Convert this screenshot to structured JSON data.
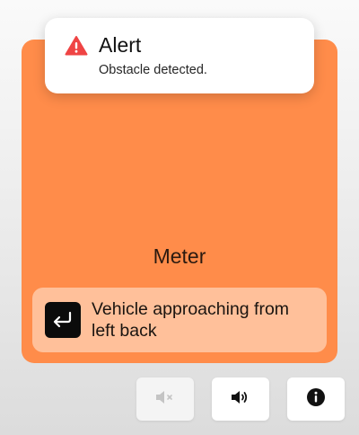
{
  "alert": {
    "title": "Alert",
    "message": "Obstacle detected.",
    "icon": "warning-icon",
    "icon_color": "#ef4444"
  },
  "panel": {
    "background": "#ff8c4a",
    "label": "Meter",
    "notice": {
      "icon": "return-arrow-icon",
      "text": "Vehicle approaching from left back"
    }
  },
  "controls": [
    {
      "name": "mute",
      "icon": "speaker-muted-icon",
      "enabled": false
    },
    {
      "name": "volume",
      "icon": "speaker-volume-icon",
      "enabled": true
    },
    {
      "name": "info",
      "icon": "info-icon",
      "enabled": true
    }
  ]
}
